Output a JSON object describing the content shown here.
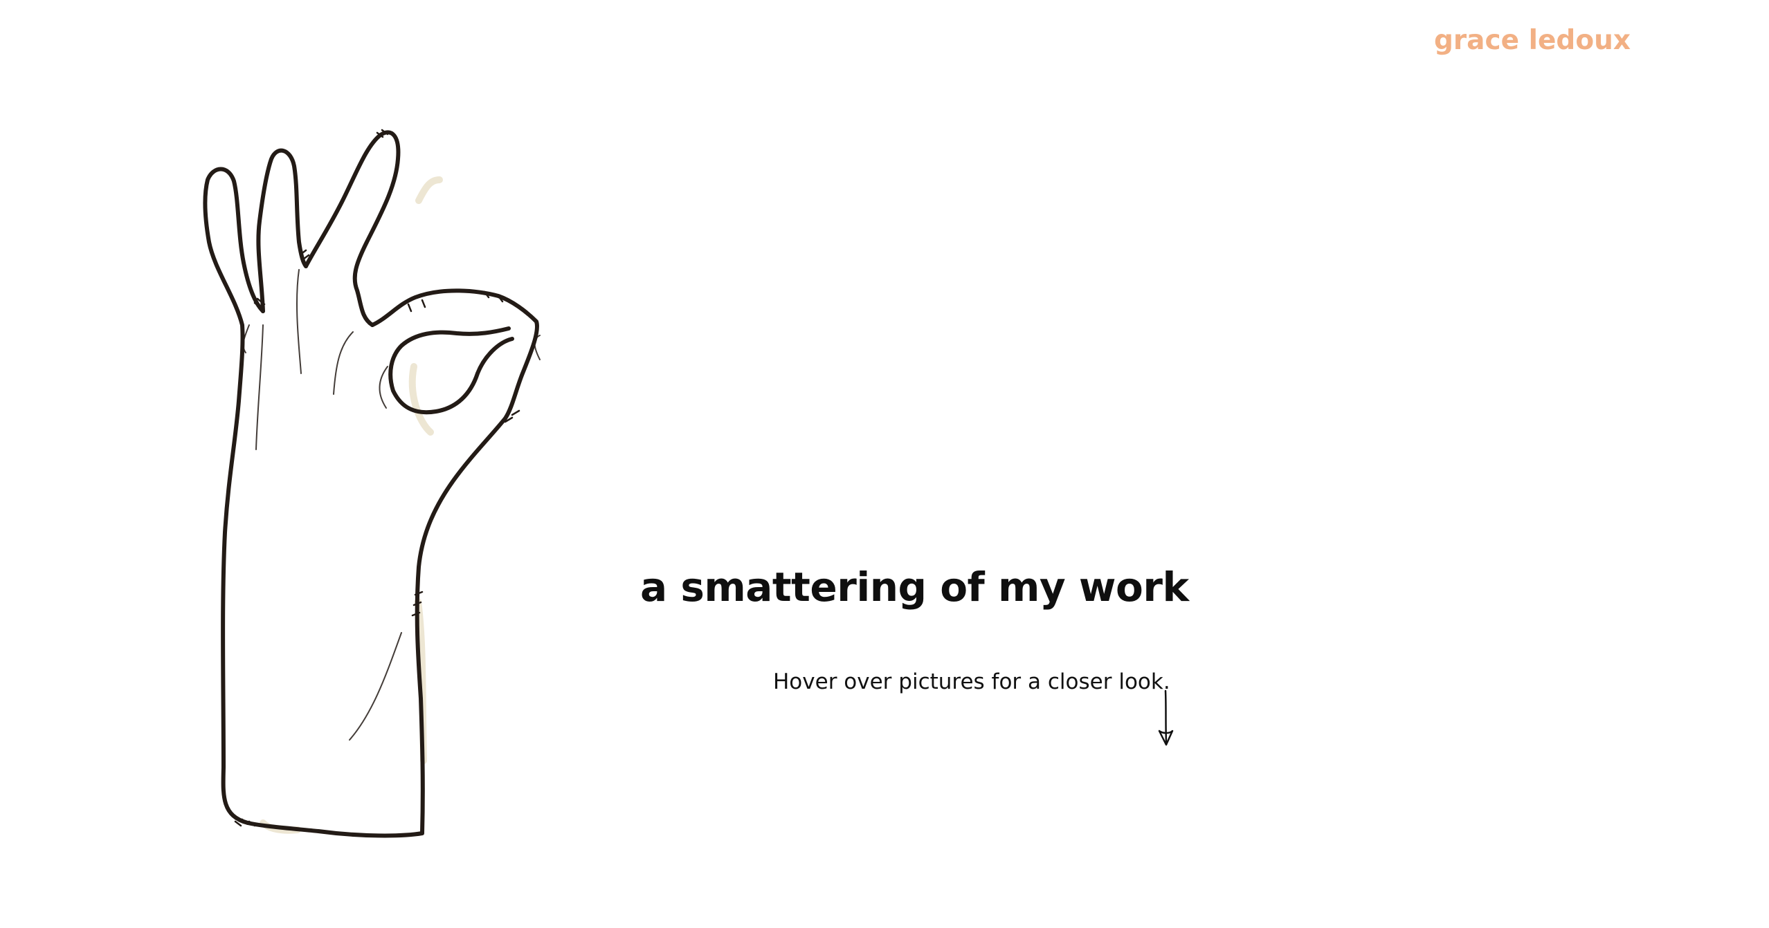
{
  "header": {
    "brand": "grace ledoux"
  },
  "hero": {
    "image_alt": "wire sculpture of a hand making an OK gesture",
    "heading": "a smattering of my work",
    "hint": "Hover over pictures for a closer look.",
    "scroll_icon": "arrow-down-icon"
  },
  "colors": {
    "brand": "#f2b084",
    "text": "#111111",
    "wire": "#231b16",
    "background": "#ffffff"
  }
}
